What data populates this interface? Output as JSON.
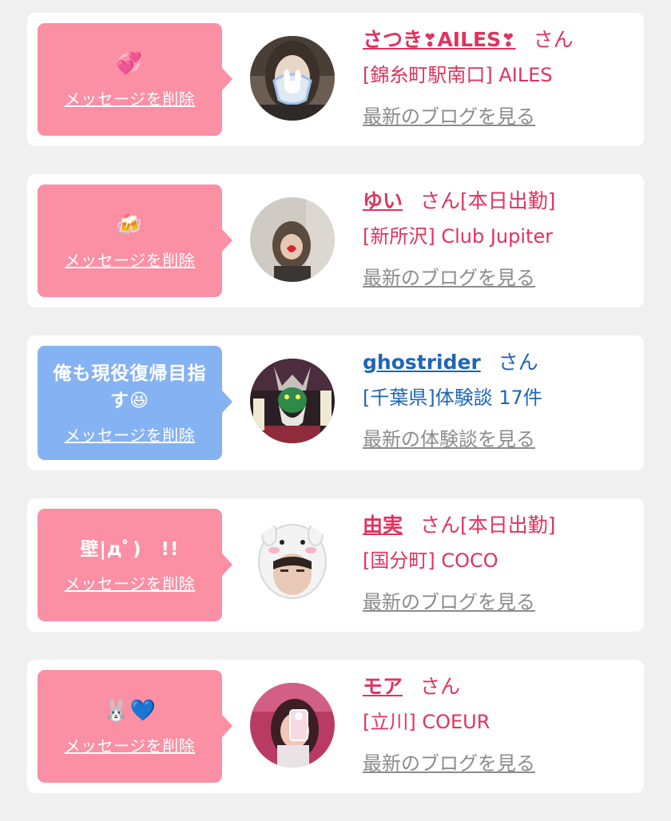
{
  "cards": [
    {
      "message": "💞",
      "delete_label": "メッセージを削除",
      "name_prefix": "さつき",
      "name_mid": "AILES",
      "san": "さん",
      "shop": "[錦糸町駅南口] AILES",
      "blog": "最新のブログを見る",
      "color": "#e0335e"
    },
    {
      "message": "🍻",
      "delete_label": "メッセージを削除",
      "name": "ゆい",
      "san": "さん",
      "status": "[本日出勤]",
      "shop": "[新所沢] Club Jupiter",
      "blog": "最新のブログを見る",
      "color": "#e0335e"
    },
    {
      "message": "俺も現役復帰目指す😆",
      "delete_label": "メッセージを削除",
      "name": "ghostrider",
      "san": "さん",
      "shop": "[千葉県]体験談 17件",
      "blog": "最新の体験談を見る",
      "color": "#1f65b6"
    },
    {
      "message": "壁|дﾟ)　!!",
      "delete_label": "メッセージを削除",
      "name": "由実",
      "san": "さん",
      "status": "[本日出勤]",
      "shop": "[国分町] COCO",
      "blog": "最新のブログを見る",
      "color": "#e0335e"
    },
    {
      "message": "🐰💙",
      "delete_label": "メッセージを削除",
      "name": "モア",
      "san": "さん",
      "shop": "[立川] COEUR",
      "blog": "最新のブログを見る",
      "color": "#e0335e"
    }
  ]
}
